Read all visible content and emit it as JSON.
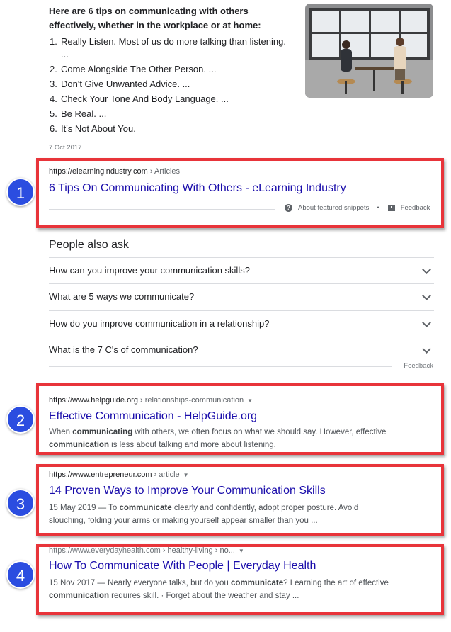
{
  "featured_snippet": {
    "heading": "Here are 6 tips on communicating with others effectively, whether in the workplace or at home:",
    "tips": [
      {
        "num": "1.",
        "text": "Really Listen. Most of us do more talking than listening.",
        "cont": "..."
      },
      {
        "num": "2.",
        "text": "Come Alongside The Other Person. ...",
        "cont": ""
      },
      {
        "num": "3.",
        "text": "Don't Give Unwanted Advice. ...",
        "cont": ""
      },
      {
        "num": "4.",
        "text": "Check Your Tone And Body Language. ...",
        "cont": ""
      },
      {
        "num": "5.",
        "text": "Be Real. ...",
        "cont": ""
      },
      {
        "num": "6.",
        "text": "It's Not About You.",
        "cont": ""
      }
    ],
    "date": "7 Oct 2017",
    "source_url": "https://elearningindustry.com",
    "source_crumb": "› Articles",
    "source_title": "6 Tips On Communicating With Others - eLearning Industry",
    "about_label": "About featured snippets",
    "dot": "•",
    "feedback_label": "Feedback"
  },
  "people_also_ask": {
    "heading": "People also ask",
    "questions": [
      "How can you improve your communication skills?",
      "What are 5 ways we communicate?",
      "How do you improve communication in a relationship?",
      "What is the 7 C's of communication?"
    ],
    "feedback_label": "Feedback"
  },
  "results": [
    {
      "url": "https://www.helpguide.org",
      "crumb": "› relationships-communication",
      "title": "Effective Communication - HelpGuide.org",
      "desc_parts": [
        "When ",
        "communicating",
        " with others, we often focus on what we should say. However, effective ",
        "communication",
        " is less about talking and more about listening."
      ]
    },
    {
      "url": "https://www.entrepreneur.com",
      "crumb": "› article",
      "title": "14 Proven Ways to Improve Your Communication Skills",
      "desc_parts": [
        "15 May 2019 — To ",
        "communicate",
        " clearly and confidently, adopt proper posture. Avoid slouching, folding your arms or making yourself appear smaller than you ..."
      ]
    },
    {
      "url": "https://www.everydayhealth.com",
      "crumb": "› healthy-living › no...",
      "title": "How To Communicate With People | Everyday Health",
      "desc_parts": [
        "15 Nov 2017 — Nearly everyone talks, but do you ",
        "communicate",
        "? Learning the art of effective ",
        "communication",
        " requires skill. · Forget about the weather and stay ..."
      ]
    }
  ],
  "badges": [
    "1",
    "2",
    "3",
    "4"
  ],
  "icons": {
    "caret": "▼",
    "question": "?"
  },
  "colors": {
    "annotation_red": "#e8343a",
    "badge_blue": "#2b4de0",
    "link_blue": "#1a0dab"
  }
}
